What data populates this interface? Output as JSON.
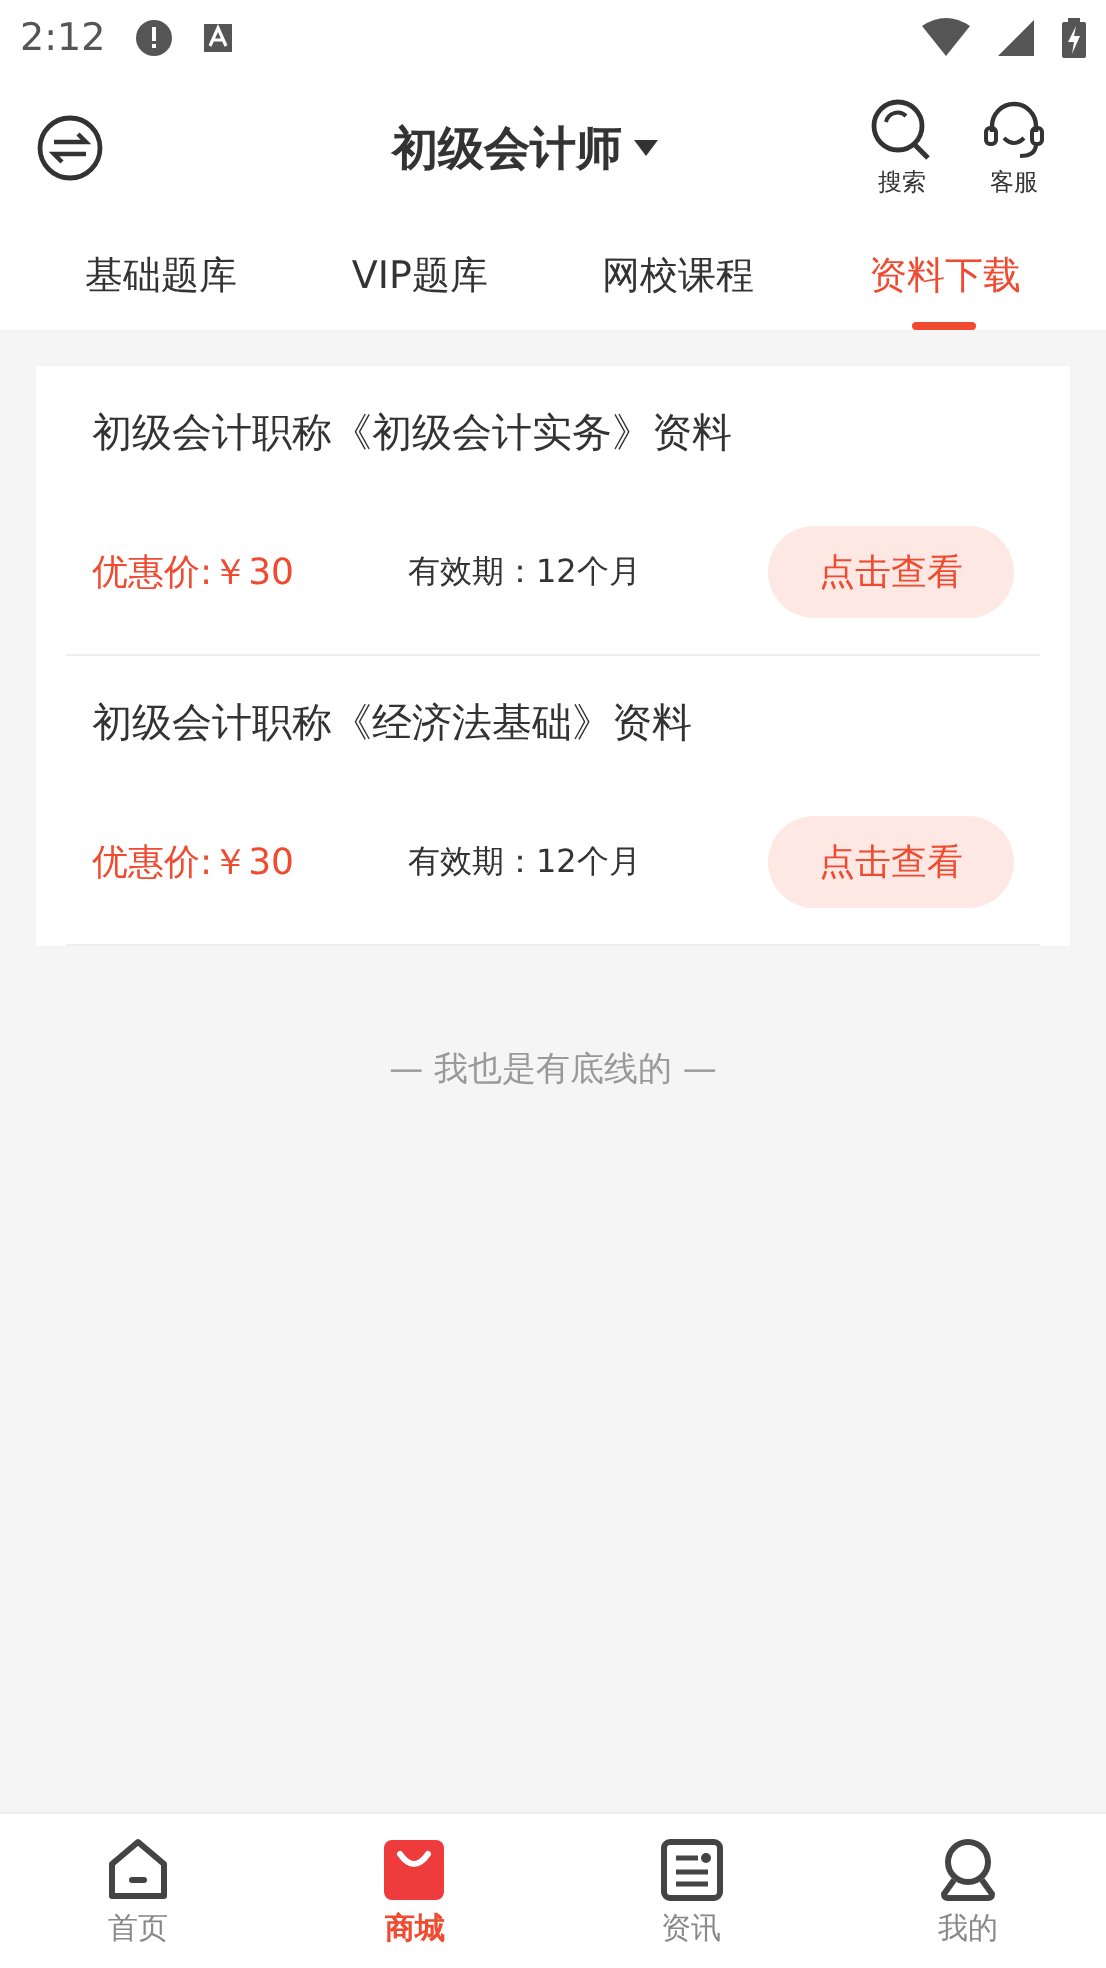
{
  "status_bar": {
    "time": "2:12"
  },
  "header": {
    "title": "初级会计师",
    "actions": [
      "搜索",
      "客服"
    ]
  },
  "tabs": [
    {
      "label": "基础题库",
      "selected": false
    },
    {
      "label": "VIP题库",
      "selected": false
    },
    {
      "label": "网校课程",
      "selected": false
    },
    {
      "label": "资料下载",
      "selected": true
    }
  ],
  "products": [
    {
      "title": "初级会计职称《初级会计实务》资料",
      "price": "优惠价:￥30",
      "validity": "有效期：12个月",
      "button": "点击查看"
    },
    {
      "title": "初级会计职称《经济法基础》资料",
      "price": "优惠价:￥30",
      "validity": "有效期：12个月",
      "button": "点击查看"
    }
  ],
  "end_note": "— 我也是有底线的 —",
  "bottom_nav": [
    {
      "label": "首页",
      "selected": false
    },
    {
      "label": "商城",
      "selected": true
    },
    {
      "label": "资讯",
      "selected": false
    },
    {
      "label": "我的",
      "selected": false
    }
  ]
}
